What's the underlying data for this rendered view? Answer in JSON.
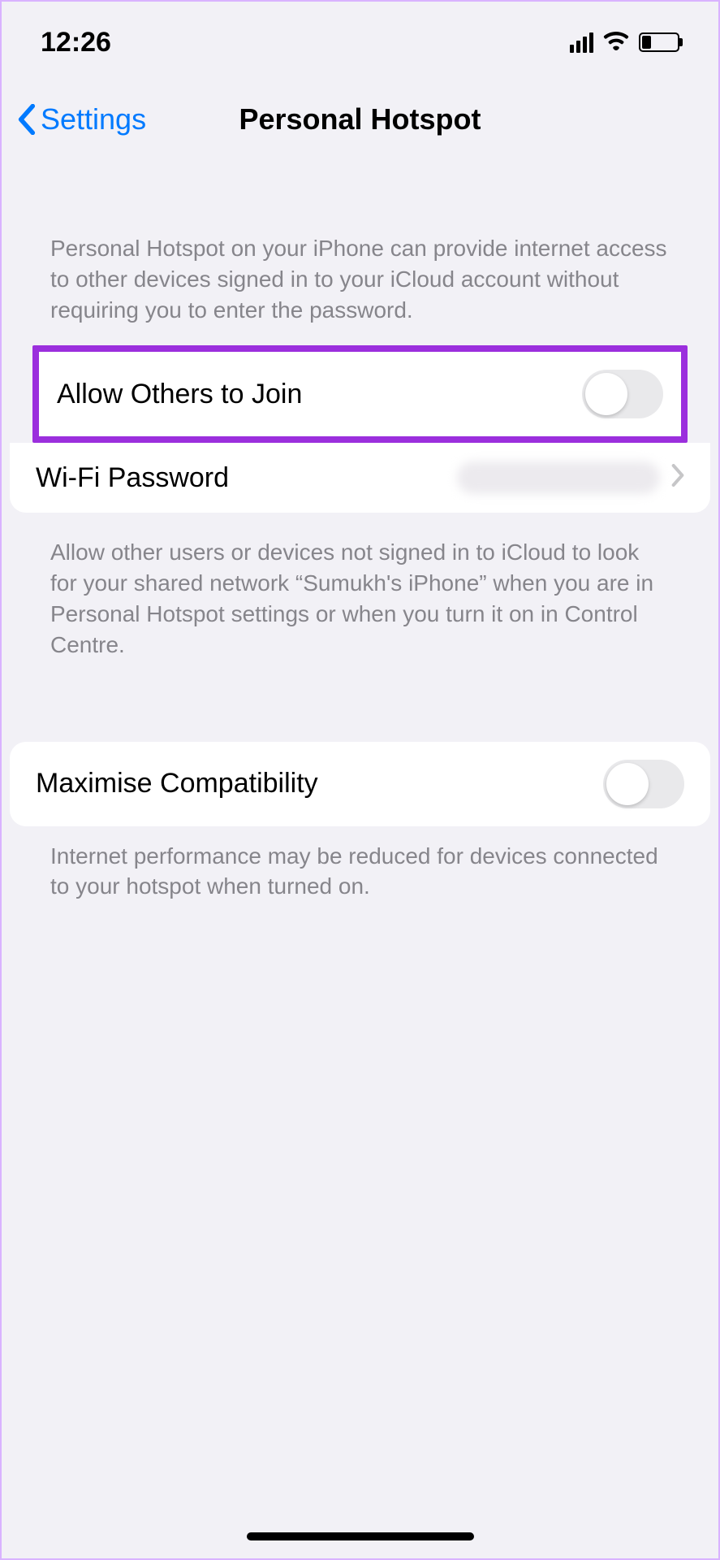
{
  "status": {
    "time": "12:26"
  },
  "nav": {
    "back_label": "Settings",
    "title": "Personal Hotspot"
  },
  "captions": {
    "intro": "Personal Hotspot on your iPhone can provide internet access to other devices signed in to your iCloud account without requiring you to enter the password.",
    "allow_footer": "Allow other users or devices not signed in to iCloud to look for your shared network “Sumukh's iPhone” when you are in Personal Hotspot settings or when you turn it on in Control Centre.",
    "compat_footer": "Internet performance may be reduced for devices connected to your hotspot when turned on."
  },
  "rows": {
    "allow_others": {
      "label": "Allow Others to Join",
      "value": false
    },
    "wifi_password": {
      "label": "Wi-Fi Password"
    },
    "maximise_compat": {
      "label": "Maximise Compatibility",
      "value": false
    }
  }
}
